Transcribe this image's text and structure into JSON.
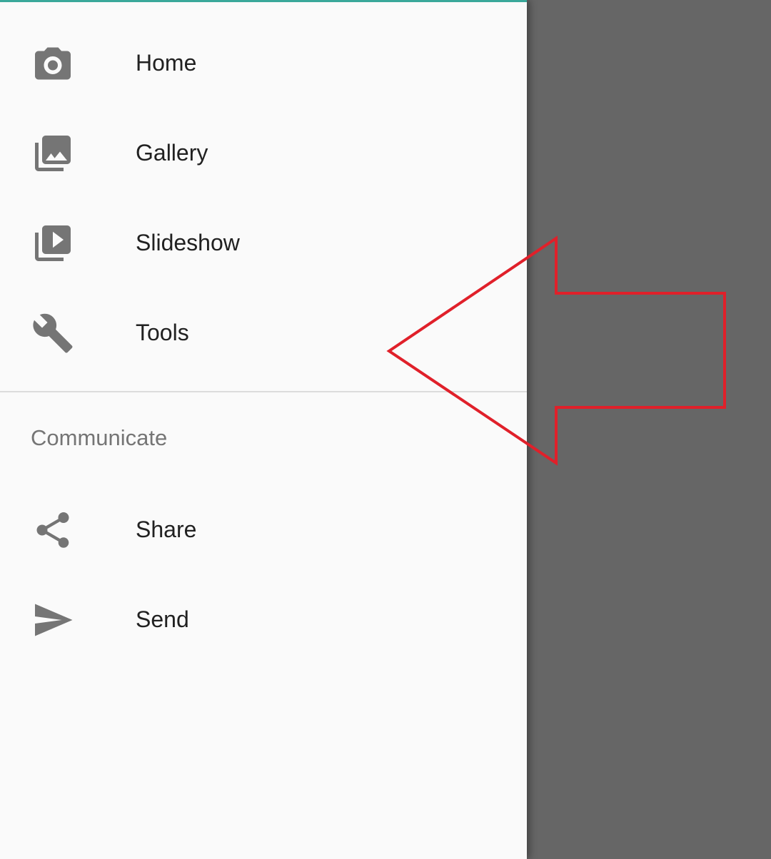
{
  "drawer": {
    "items": [
      {
        "label": "Home",
        "icon": "camera-icon"
      },
      {
        "label": "Gallery",
        "icon": "gallery-icon"
      },
      {
        "label": "Slideshow",
        "icon": "slideshow-icon"
      },
      {
        "label": "Tools",
        "icon": "wrench-icon"
      }
    ],
    "section": {
      "title": "Communicate",
      "items": [
        {
          "label": "Share",
          "icon": "share-icon"
        },
        {
          "label": "Send",
          "icon": "send-icon"
        }
      ]
    }
  },
  "colors": {
    "drawer_background": "#fafafa",
    "scrim": "#666666",
    "icon": "#757575",
    "text": "#212121",
    "section_header": "#757575",
    "divider": "#dcdcdc",
    "top_accent": "#3aa89a",
    "annotation_arrow": "#e0202a"
  },
  "annotation": {
    "icon": "left-arrow-annotation-icon"
  }
}
